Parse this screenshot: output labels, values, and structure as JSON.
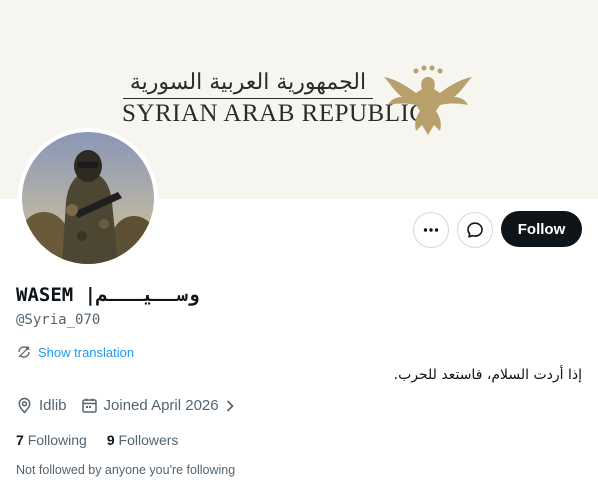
{
  "banner": {
    "arabic_title": "الجمهورية العربية السورية",
    "english_title": "SYRIAN ARAB REPUBLIC",
    "emblem_icon": "eagle-emblem-icon",
    "accent_color": "#b8a06a"
  },
  "actions": {
    "more_icon": "more-dots-icon",
    "message_icon": "message-icon",
    "follow_label": "Follow"
  },
  "profile": {
    "display_name": "WASEM |وســيـــم",
    "handle": "@Syria_070",
    "translate_label": "Show translation",
    "bio": "إذا أردت السلام، فاستعد للحرب.",
    "location": "Idlib",
    "joined": "Joined April 2026",
    "following_count": "7",
    "following_label": "Following",
    "followers_count": "9",
    "followers_label": "Followers",
    "followed_note": "Not followed by anyone you're following"
  }
}
